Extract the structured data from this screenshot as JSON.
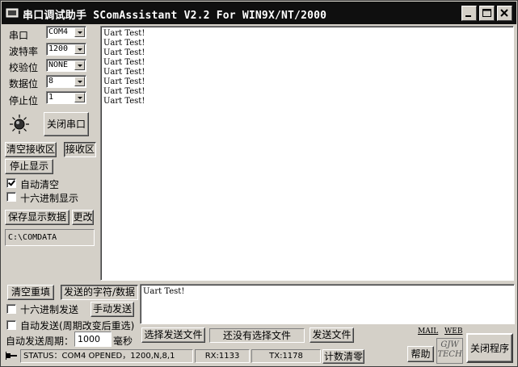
{
  "window": {
    "title": "串口调试助手  SComAssistant V2.2 For WIN9X/NT/2000",
    "controls": [
      "minimize",
      "maximize",
      "close"
    ]
  },
  "settings": [
    {
      "label": "串口",
      "value": "COM4"
    },
    {
      "label": "波特率",
      "value": "1200"
    },
    {
      "label": "校验位",
      "value": "NONE"
    },
    {
      "label": "数据位",
      "value": "8"
    },
    {
      "label": "停止位",
      "value": "1"
    }
  ],
  "port": {
    "indicator_icon": "port-indicator-icon",
    "close_port_label": "关闭串口"
  },
  "receive": {
    "clear_label": "清空接收区",
    "area_label": "接收区",
    "stop_display_label": "停止显示",
    "auto_clear_label": "自动清空",
    "auto_clear_checked": true,
    "hex_display_label": "十六进制显示",
    "hex_display_checked": false,
    "save_label": "保存显示数据",
    "change_label": "更改",
    "save_path": "C:\\COMDATA",
    "lines": [
      "Uart Test!",
      "Uart Test!",
      "Uart Test!",
      "Uart Test!",
      "Uart Test!",
      "Uart Test!",
      "Uart Test!",
      "Uart Test!"
    ]
  },
  "send": {
    "clear_label": "清空重填",
    "area_label": "发送的字符/数据",
    "hex_send_label": "十六进制发送",
    "hex_send_checked": false,
    "manual_send_label": "手动发送",
    "auto_send_label": "自动发送(周期改变后重选)",
    "auto_send_checked": false,
    "period_label": "自动发送周期：",
    "period_value": "1000",
    "period_unit": "毫秒",
    "text": "Uart Test!",
    "select_file_label": "选择发送文件",
    "file_status": "还没有选择文件",
    "send_file_label": "发送文件"
  },
  "links": {
    "mail": "MAIL",
    "web": "WEB"
  },
  "footer": {
    "status": "STATUS：COM4 OPENED，1200,N,8,1",
    "rx": "RX:1133",
    "tx": "TX:1178",
    "reset_count_label": "计数清零",
    "help_label": "帮助",
    "logo_text": [
      "GJW",
      "TECH"
    ],
    "exit_label": "关闭程序"
  }
}
